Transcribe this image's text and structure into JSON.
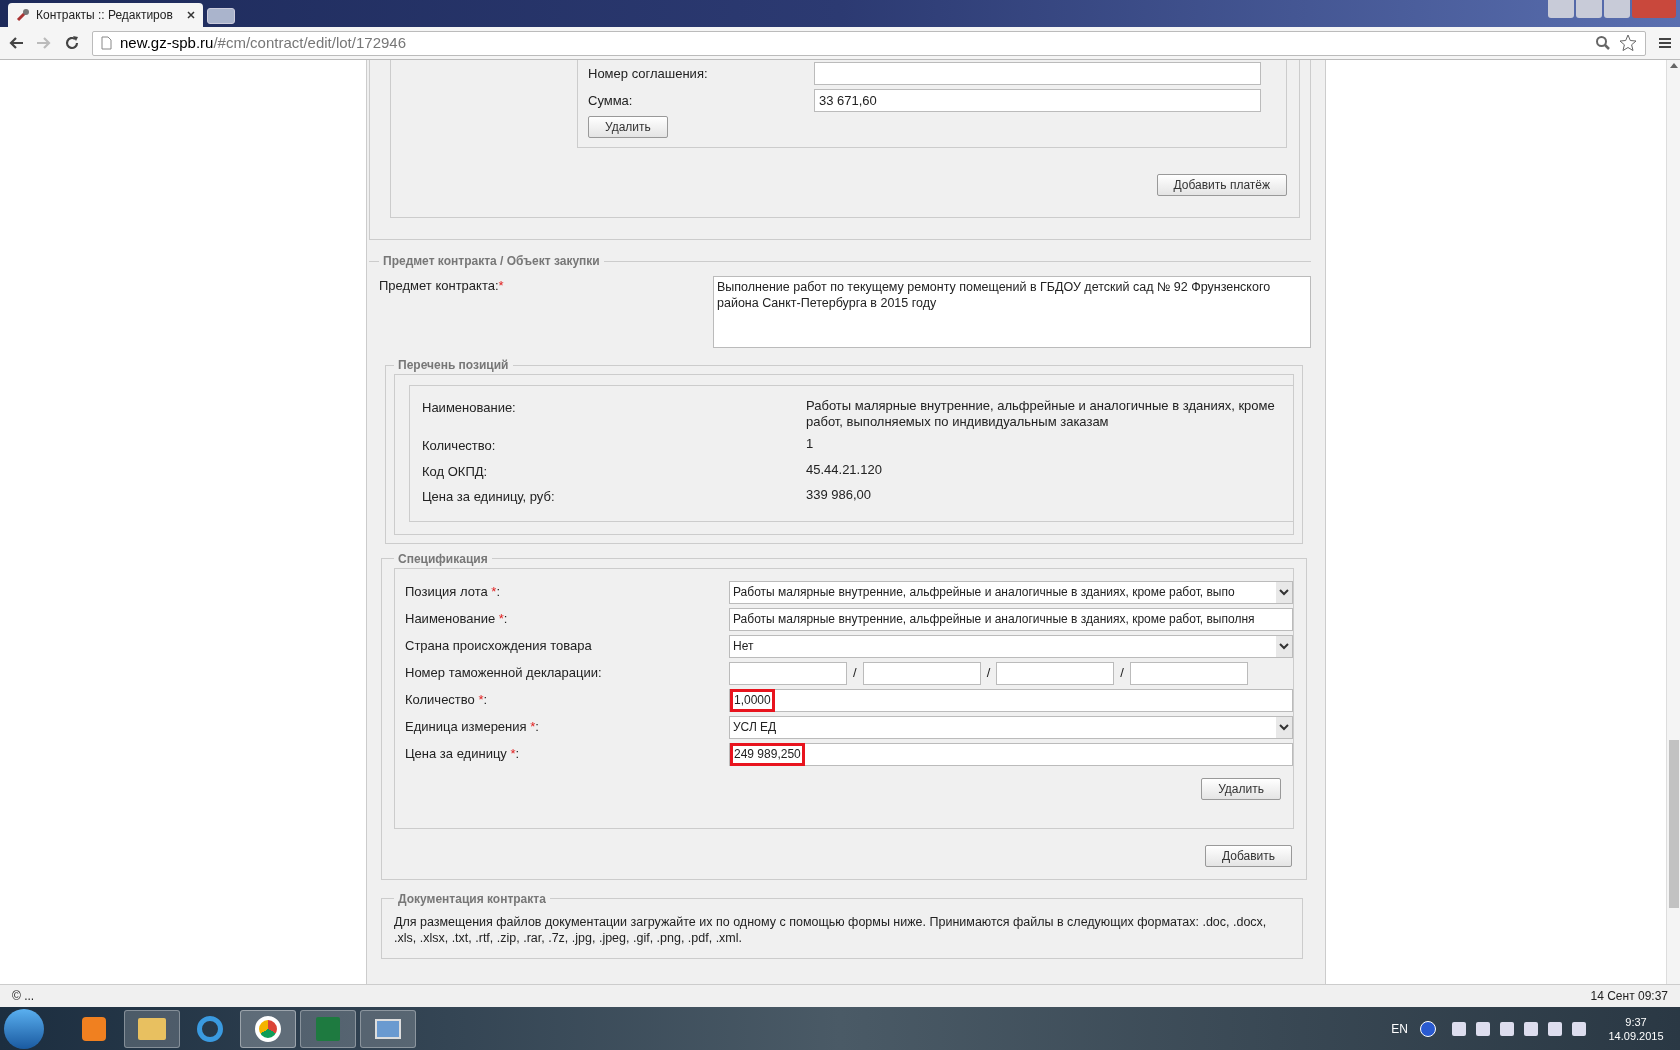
{
  "browser": {
    "tab_title": "Контракты :: Редактиров",
    "url_host": "new.gz-spb.ru",
    "url_path": "/#cm/contract/edit/lot/172946"
  },
  "payment": {
    "fields": [
      {
        "label": "Номер соглашения:"
      },
      {
        "label": "Сумма:",
        "value": "33 671,60"
      }
    ],
    "delete_button": "Удалить",
    "add_button": "Добавить платёж"
  },
  "required_mark": "*",
  "subject": {
    "legend": "Предмет контракта / Объект закупки",
    "label": "Предмет контракта:",
    "required": true,
    "value": "Выполнение работ по текущему ремонту помещений в ГБДОУ детский сад № 92 Фрунзенского района Санкт-Петербурга в 2015 году"
  },
  "positions": {
    "legend": "Перечень позиций",
    "rows": [
      {
        "label": "Наименование:",
        "value": "Работы малярные внутренние, альфрейные и аналогичные в зданиях, кроме работ, выполняемых по индивидуальным заказам"
      },
      {
        "label": "Количество:",
        "value": "1"
      },
      {
        "label": "Код ОКПД:",
        "value": "45.44.21.120"
      },
      {
        "label": "Цена за единицу, руб:",
        "value": "339 986,00"
      }
    ]
  },
  "specification": {
    "legend": "Спецификация",
    "fields": [
      {
        "kind": "select",
        "label": "Позиция лота",
        "required": true,
        "label_end": ":",
        "value": "Работы малярные внутренние, альфрейные и аналогичные в зданиях, кроме работ, выпо"
      },
      {
        "kind": "input",
        "label": "Наименование",
        "required": true,
        "label_end": ":",
        "value": "Работы малярные внутренние, альфрейные и аналогичные в зданиях, кроме работ, выполня",
        "highlighted": false
      },
      {
        "kind": "select",
        "label": "Страна происхождения товара",
        "required": false,
        "value": "Нет"
      },
      {
        "kind": "customs",
        "label": "Номер таможенной декларации:",
        "required": false,
        "separators": [
          "/",
          "/",
          "/"
        ]
      },
      {
        "kind": "input",
        "label": "Количество",
        "required": true,
        "label_end": ":",
        "value": "1,0000",
        "highlighted": true
      },
      {
        "kind": "select",
        "label": "Единица измерения",
        "required": true,
        "label_end": ":",
        "value": "УСЛ ЕД"
      },
      {
        "kind": "input",
        "label": "Цена за единицу",
        "required": true,
        "label_end": ":",
        "value": "249 989,250",
        "highlighted": true
      }
    ],
    "delete_button": "Удалить",
    "add_button": "Добавить"
  },
  "documents": {
    "legend": "Документация контракта",
    "text": "Для размещения файлов документации загружайте их по одному с помощью формы ниже. Принимаются файлы в следующих форматах: .doc, .docx, .xls, .xlsx, .txt, .rtf, .zip, .rar, .7z, .jpg, .jpeg, .gif, .png, .pdf, .xml."
  },
  "status_bar": {
    "left": "© ...",
    "right": "14 Сент 09:37"
  },
  "taskbar": {
    "language": "EN",
    "time": "9:37",
    "date": "14.09.2015"
  }
}
